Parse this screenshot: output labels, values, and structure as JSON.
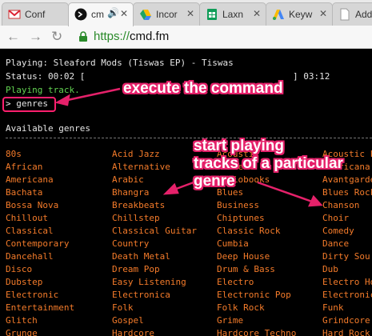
{
  "browser": {
    "tabs": [
      {
        "title": "Conf",
        "icon": "gmail-icon"
      },
      {
        "title": "cm",
        "icon": "terminal-icon"
      },
      {
        "title": "Incor",
        "icon": "google-drive-icon"
      },
      {
        "title": "Laxn",
        "icon": "google-sheets-icon"
      },
      {
        "title": "Keyw",
        "icon": "google-ads-icon"
      },
      {
        "title": "Add",
        "icon": "page-icon"
      }
    ],
    "url_scheme": "https://",
    "url_host": "cmd.fm"
  },
  "terminal": {
    "playing": "Playing: Sleaford Mods (Tiswas EP) - Tiswas",
    "status_left": "Status: 00:02 [",
    "status_right": "] 03:12",
    "notice": "Playing track.",
    "prompt": "> genres",
    "section_title": "Available genres",
    "genres": [
      [
        "80s",
        "Acid Jazz",
        "Acoustic",
        "Acoustic F"
      ],
      [
        "African",
        "Alternative",
        "Ambient",
        "Americana"
      ],
      [
        "Americana",
        "Arabic",
        "Audiobooks",
        "Avantgarde"
      ],
      [
        "Bachata",
        "Bhangra",
        "Blues",
        "Blues Rock"
      ],
      [
        "Bossa Nova",
        "Breakbeats",
        "Business",
        "Chanson"
      ],
      [
        "Chillout",
        "Chillstep",
        "Chiptunes",
        "Choir"
      ],
      [
        "Classical",
        "Classical Guitar",
        "Classic Rock",
        "Comedy"
      ],
      [
        "Contemporary",
        "Country",
        "Cumbia",
        "Dance"
      ],
      [
        "Dancehall",
        "Death Metal",
        "Deep House",
        "Dirty Sou"
      ],
      [
        "Disco",
        "Dream Pop",
        "Drum & Bass",
        "Dub"
      ],
      [
        "Dubstep",
        "Easy Listening",
        "Electro",
        "Electro Ho"
      ],
      [
        "Electronic",
        "Electronica",
        "Electronic Pop",
        "Electronic"
      ],
      [
        "Entertainment",
        "Folk",
        "Folk Rock",
        "Funk"
      ],
      [
        "Glitch",
        "Gospel",
        "Grime",
        "Grindcore"
      ],
      [
        "Grunge",
        "Hardcore",
        "Hardcore Techno",
        "Hard Rock"
      ]
    ]
  },
  "annotations": {
    "execute": "execute the command",
    "start_playing": "start playing\ntracks of a particular\ngenre"
  },
  "colors": {
    "terminal_bg": "#000000",
    "terminal_text": "#e6e6e6",
    "notice_green": "#63d452",
    "genre_orange": "#f47b2a",
    "annotation_pink": "#e5216a"
  }
}
